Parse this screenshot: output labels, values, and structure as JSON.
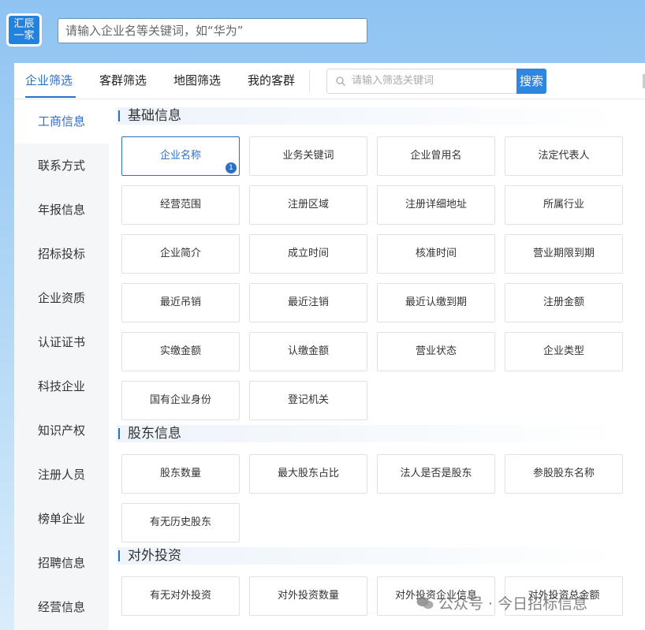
{
  "header": {
    "logo_line1": "汇辰",
    "logo_line2": "一家",
    "search_placeholder": "请输入企业名等关键词，如“华为”"
  },
  "tabs": [
    {
      "label": "企业筛选",
      "active": true
    },
    {
      "label": "客群筛选",
      "active": false
    },
    {
      "label": "地图筛选",
      "active": false
    },
    {
      "label": "我的客群",
      "active": false
    }
  ],
  "filter_search": {
    "placeholder": "请输入筛选关键词",
    "button_label": "搜索"
  },
  "sidebar": {
    "items": [
      {
        "label": "工商信息",
        "active": true
      },
      {
        "label": "联系方式"
      },
      {
        "label": "年报信息"
      },
      {
        "label": "招标投标"
      },
      {
        "label": "企业资质"
      },
      {
        "label": "认证证书"
      },
      {
        "label": "科技企业"
      },
      {
        "label": "知识产权"
      },
      {
        "label": "注册人员"
      },
      {
        "label": "榜单企业"
      },
      {
        "label": "招聘信息"
      },
      {
        "label": "经营信息"
      }
    ]
  },
  "sections": [
    {
      "title": "基础信息",
      "options": [
        {
          "label": "企业名称",
          "selected": true,
          "badge": "1"
        },
        {
          "label": "业务关键词"
        },
        {
          "label": "企业曾用名"
        },
        {
          "label": "法定代表人"
        },
        {
          "label": "经营范围"
        },
        {
          "label": "注册区域"
        },
        {
          "label": "注册详细地址"
        },
        {
          "label": "所属行业"
        },
        {
          "label": "企业简介"
        },
        {
          "label": "成立时间"
        },
        {
          "label": "核准时间"
        },
        {
          "label": "营业期限到期"
        },
        {
          "label": "最近吊销"
        },
        {
          "label": "最近注销"
        },
        {
          "label": "最近认缴到期"
        },
        {
          "label": "注册金额"
        },
        {
          "label": "实缴金额"
        },
        {
          "label": "认缴金额"
        },
        {
          "label": "营业状态"
        },
        {
          "label": "企业类型"
        },
        {
          "label": "国有企业身份"
        },
        {
          "label": "登记机关"
        }
      ]
    },
    {
      "title": "股东信息",
      "options": [
        {
          "label": "股东数量"
        },
        {
          "label": "最大股东占比"
        },
        {
          "label": "法人是否是股东"
        },
        {
          "label": "参股股东名称"
        },
        {
          "label": "有无历史股东"
        }
      ]
    },
    {
      "title": "对外投资",
      "options": [
        {
          "label": "有无对外投资"
        },
        {
          "label": "对外投资数量"
        },
        {
          "label": "对外投资企业信息"
        },
        {
          "label": "对外投资总金额"
        }
      ]
    }
  ],
  "watermark": "公众号 · 今日招标信息",
  "colors": {
    "accent": "#2b6fc7",
    "search_button": "#2f86e0",
    "logo_bg": "#1f83df",
    "background_top": "#8fc3f2"
  }
}
